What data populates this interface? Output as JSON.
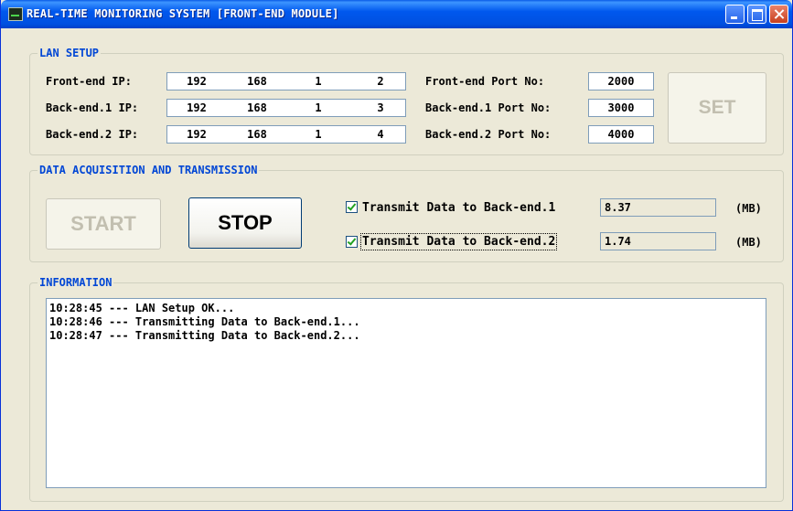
{
  "window": {
    "title": "REAL-TIME MONITORING SYSTEM [FRONT-END MODULE]"
  },
  "lan_setup": {
    "title": "LAN SETUP",
    "rows": [
      {
        "ip_label": "Front-end  IP:",
        "ip": [
          "192",
          "168",
          "1",
          "2"
        ],
        "port_label": "Front-end  Port No:",
        "port": "2000"
      },
      {
        "ip_label": "Back-end.1 IP:",
        "ip": [
          "192",
          "168",
          "1",
          "3"
        ],
        "port_label": "Back-end.1 Port No:",
        "port": "3000"
      },
      {
        "ip_label": "Back-end.2 IP:",
        "ip": [
          "192",
          "168",
          "1",
          "4"
        ],
        "port_label": "Back-end.2 Port No:",
        "port": "4000"
      }
    ],
    "set_label": "SET"
  },
  "data_acq": {
    "title": "DATA ACQUISITION AND TRANSMISSION",
    "start_label": "START",
    "stop_label": "STOP",
    "transmit": [
      {
        "label": "Transmit Data to Back-end.1",
        "checked": true,
        "value": "8.37",
        "unit": "(MB)"
      },
      {
        "label": "Transmit Data to Back-end.2",
        "checked": true,
        "value": "1.74",
        "unit": "(MB)"
      }
    ]
  },
  "information": {
    "title": "INFORMATION",
    "log": [
      "10:28:45 --- LAN Setup OK...",
      "10:28:46 --- Transmitting Data to Back-end.1...",
      "10:28:47 --- Transmitting Data to Back-end.2..."
    ]
  }
}
